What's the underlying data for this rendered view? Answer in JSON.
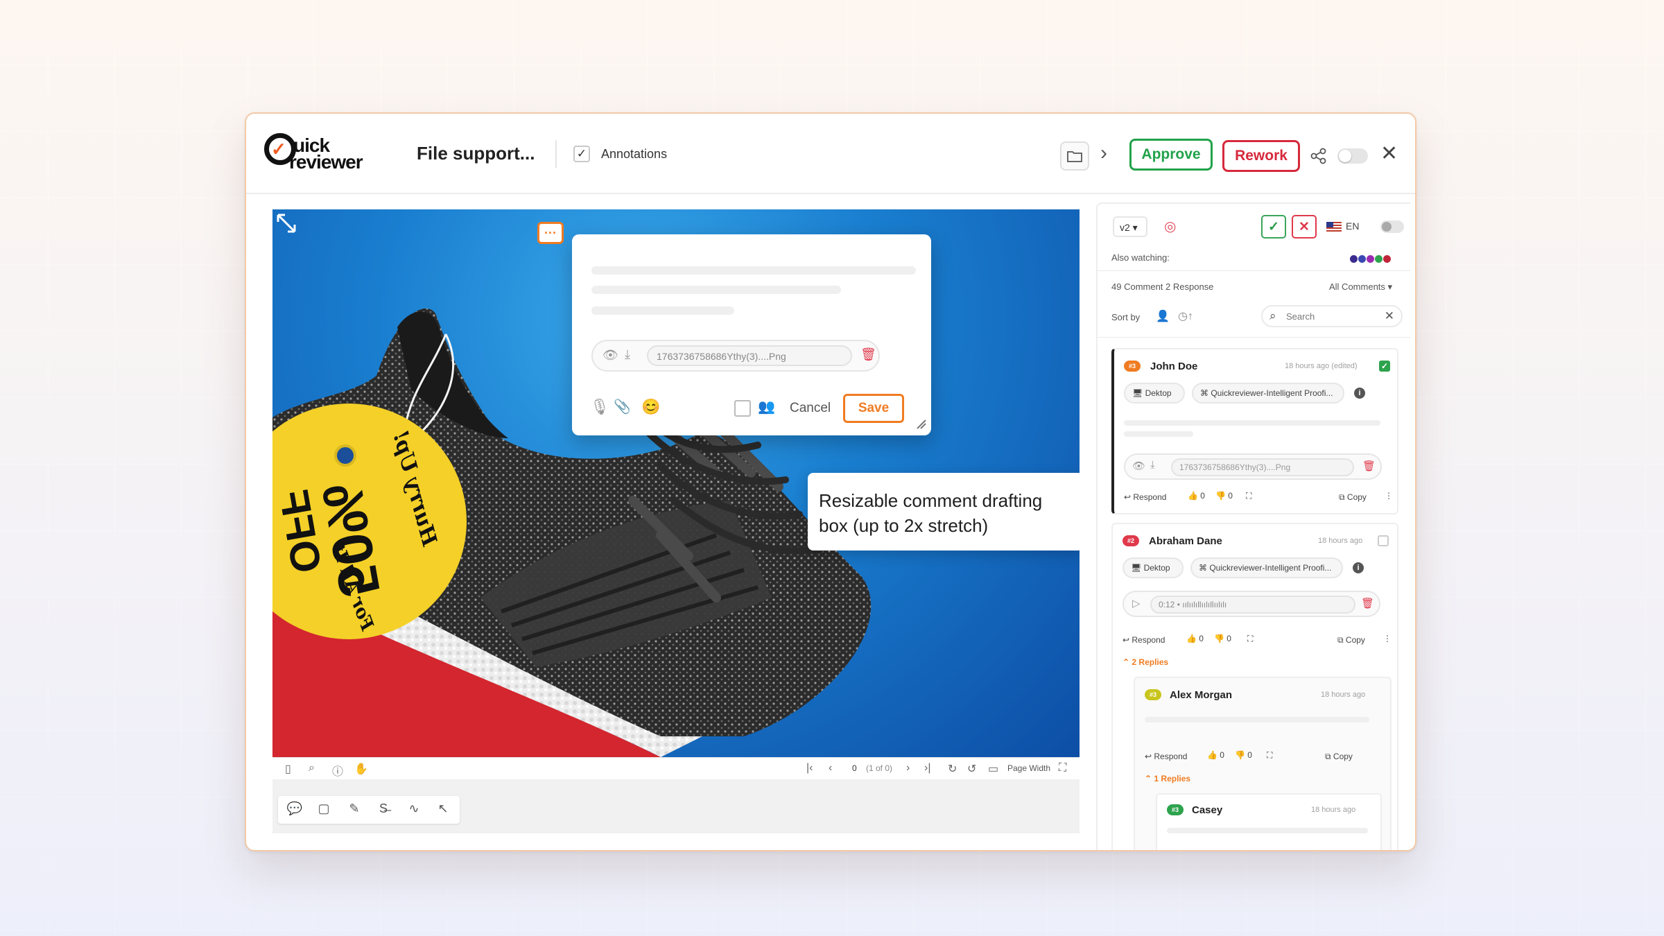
{
  "header": {
    "logo_line1": "uick",
    "logo_line2": "reviewer",
    "file_title": "File support...",
    "annotations_label": "Annotations",
    "approve_label": "Approve",
    "rework_label": "Rework"
  },
  "canvas": {
    "tag_line1": "Hurry Up!",
    "tag_line2": "50%",
    "tag_line3": "OFF",
    "tag_line4": "For All It",
    "callout_text": "Resizable comment drafting box (up to 2x stretch)"
  },
  "draft": {
    "file_name": "1763736758686Ythy(3)....Png",
    "cancel_label": "Cancel",
    "save_label": "Save"
  },
  "viewer_toolbar": {
    "page_current": "0",
    "page_of": "(1 of 0)",
    "page_width_label": "Page Width"
  },
  "panel": {
    "version": "v2",
    "language": "EN",
    "also_watching": "Also watching:",
    "watcher_colors": [
      "#3b2b8f",
      "#3a47b3",
      "#9b2bb0",
      "#2ea34e",
      "#c0263a"
    ],
    "comment_count": "49 Comment 2 Response",
    "filter_label": "All Comments",
    "sort_by": "Sort by",
    "search_placeholder": "Search",
    "comments": [
      {
        "badge": "#3",
        "badge_color": "#f07c22",
        "author": "John Doe",
        "time": "18 hours ago (edited)",
        "device": "Dektop",
        "source": "Quickreviewer-Intelligent Proofi...",
        "attachment": "1763736758686Ythy(3)....Png",
        "respond": "Respond",
        "likes": "0",
        "dislikes": "0",
        "copy": "Copy"
      },
      {
        "badge": "#2",
        "badge_color": "#e0394b",
        "author": "Abraham Dane",
        "time": "18 hours ago",
        "device": "Dektop",
        "source": "Quickreviewer-Intelligent Proofi...",
        "audio_time": "0:12",
        "respond": "Respond",
        "likes": "0",
        "dislikes": "0",
        "copy": "Copy",
        "replies_label": "2 Replies"
      }
    ],
    "reply": {
      "badge": "#3",
      "badge_color": "#c9c51f",
      "author": "Alex Morgan",
      "time": "18 hours ago",
      "respond": "Respond",
      "likes": "0",
      "dislikes": "0",
      "copy": "Copy",
      "replies_label": "1 Replies"
    },
    "nested_reply": {
      "badge": "#3",
      "badge_color": "#2ea34e",
      "author": "Casey",
      "time": "18 hours ago"
    }
  }
}
